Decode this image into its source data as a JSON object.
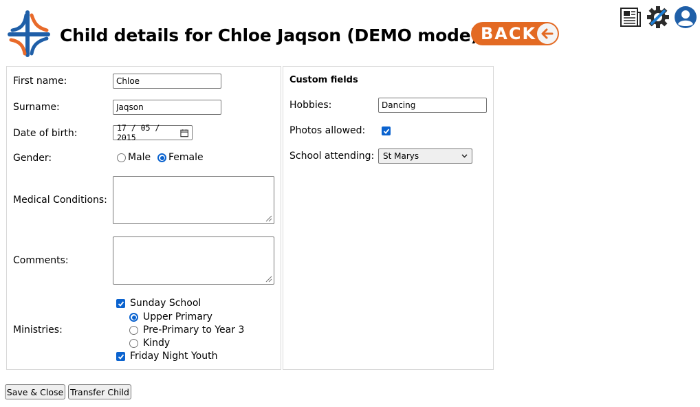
{
  "header": {
    "title": "Child details for Chloe Jaqson (DEMO mode)",
    "back_label": "BACK",
    "logo_icon": "church-cross-logo-icon",
    "icons": [
      "newspaper-icon",
      "gear-icon",
      "user-account-icon"
    ]
  },
  "child": {
    "first_name_label": "First name:",
    "first_name_value": "Chloe",
    "surname_label": "Surname:",
    "surname_value": "Jaqson",
    "dob_label": "Date of birth:",
    "dob_day": "17",
    "dob_month": "05",
    "dob_year": "2015",
    "gender_label": "Gender:",
    "gender_options": [
      "Male",
      "Female"
    ],
    "gender_selected": "Female",
    "medical_label": "Medical Conditions:",
    "medical_value": "",
    "comments_label": "Comments:",
    "comments_value": "",
    "ministries_label": "Ministries:",
    "ministries": {
      "sunday_school": "Sunday School",
      "sunday_school_checked": true,
      "sub_options": [
        "Upper Primary",
        "Pre-Primary to Year 3",
        "Kindy"
      ],
      "sub_selected": "Upper Primary",
      "friday_youth": "Friday Night Youth",
      "friday_youth_checked": true
    }
  },
  "custom": {
    "title": "Custom fields",
    "hobbies_label": "Hobbies:",
    "hobbies_value": "Dancing",
    "photos_label": "Photos allowed:",
    "photos_checked": true,
    "school_label": "School attending:",
    "school_value": "St Marys"
  },
  "actions": {
    "save_label": "Save & Close",
    "transfer_label": "Transfer Child"
  },
  "colors": {
    "accent_blue": "#0b63cf",
    "back_orange": "#e36a23",
    "logo_blue": "#1f5fa8",
    "logo_orange": "#e86a2a"
  }
}
